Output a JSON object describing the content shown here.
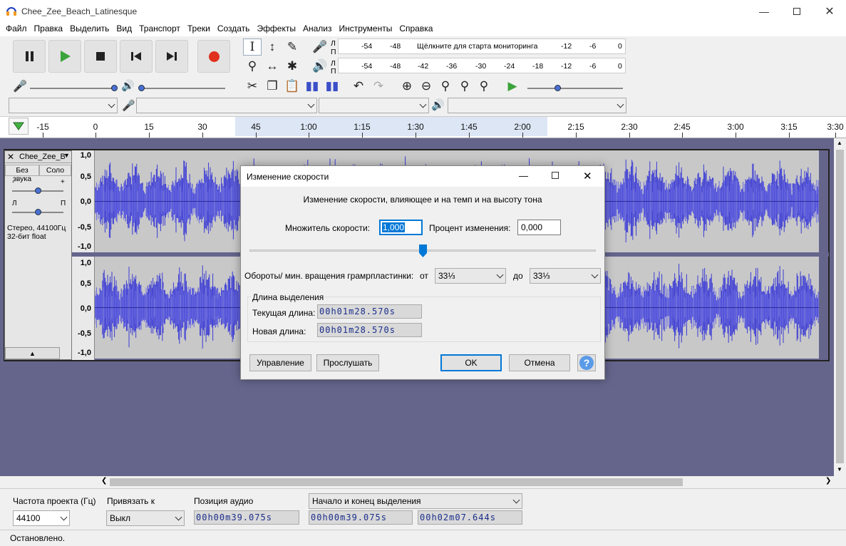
{
  "window": {
    "title": "Chee_Zee_Beach_Latinesque"
  },
  "menu": [
    "Файл",
    "Правка",
    "Выделить",
    "Вид",
    "Транспорт",
    "Треки",
    "Создать",
    "Эффекты",
    "Анализ",
    "Инструменты",
    "Справка"
  ],
  "meters": {
    "record_ticks": [
      "-54",
      "-48",
      "-12",
      "-6",
      "0"
    ],
    "record_prompt": "Щёлкните для старта мониторинга",
    "play_ticks": [
      "-54",
      "-48",
      "-42",
      "-36",
      "-30",
      "-24",
      "-18",
      "-12",
      "-6",
      "0"
    ],
    "channel_l": "Л",
    "channel_r": "П"
  },
  "ruler": {
    "labels": [
      "-15",
      "0",
      "15",
      "30",
      "45",
      "1:00",
      "1:15",
      "1:30",
      "1:45",
      "2:00",
      "2:15",
      "2:30",
      "2:45",
      "3:00",
      "3:15",
      "3:30"
    ]
  },
  "track": {
    "name": "Chee_Zee_B",
    "mute": "Без звука",
    "solo": "Соло",
    "pan_l": "Л",
    "pan_r": "П",
    "gain_minus": "-",
    "gain_plus": "+",
    "info_line1": "Стерео, 44100Гц",
    "info_line2": "32-бит float",
    "scale": [
      "1,0",
      "0,5",
      "0,0",
      "-0,5",
      "-1,0"
    ]
  },
  "dialog": {
    "title": "Изменение скорости",
    "description": "Изменение скорости, влияющее и на темп и на высоту тона",
    "multiplier_label": "Множитель скорости:",
    "multiplier_value": "1,000",
    "percent_label": "Процент изменения:",
    "percent_value": "0,000",
    "slider_fraction": 0.5,
    "rpm_label": "Обороты/ мин. вращения грамрпластинки:",
    "from_label": "от",
    "from_value": "33⅓",
    "to_label": "до",
    "to_value": "33⅓",
    "group_label": "Длина выделения",
    "current_label": "Текущая длина:",
    "current_value": "00h01m28.570s",
    "new_label": "Новая длина:",
    "new_value": "00h01m28.570s",
    "manage_btn": "Управление",
    "preview_btn": "Прослушать",
    "ok_btn": "OK",
    "cancel_btn": "Отмена",
    "help_btn": "?"
  },
  "bottom": {
    "rate_label": "Частота проекта (Гц)",
    "rate_value": "44100",
    "snap_label": "Привязать к",
    "snap_value": "Выкл",
    "pos_label": "Позиция аудио",
    "pos_value": "00h00m39.075s",
    "sel_label": "Начало и конец выделения",
    "sel_start": "00h00m39.075s",
    "sel_end": "00h02m07.644s"
  },
  "status": "Остановлено.",
  "colors": {
    "wave": "#3b3bd6",
    "wave_bg": "#c8c8c8",
    "tracks_bg": "#65658c",
    "ok_border": "#0078d7"
  }
}
